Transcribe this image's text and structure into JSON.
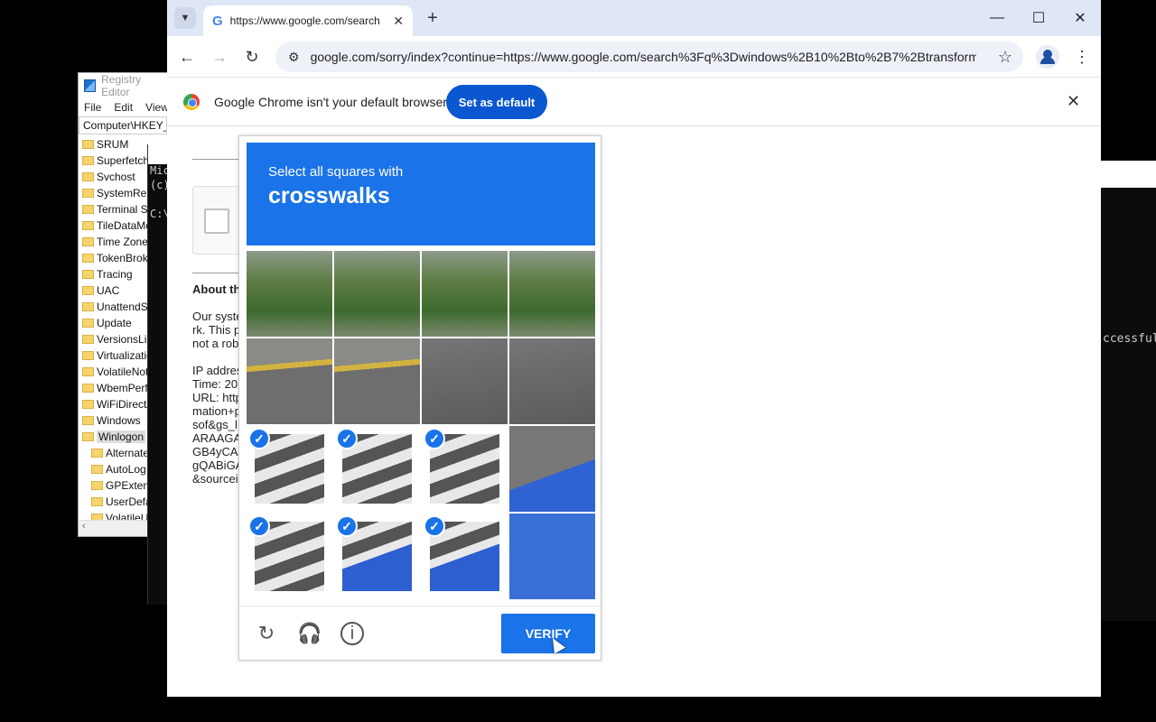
{
  "regedit": {
    "title": "Registry Editor",
    "menu": [
      "File",
      "Edit",
      "View"
    ],
    "address": "Computer\\HKEY_",
    "items": [
      "SRUM",
      "Superfetch",
      "Svchost",
      "SystemRest",
      "Terminal Se",
      "TileDataMo",
      "Time Zones",
      "TokenBroke",
      "Tracing",
      "UAC",
      "UnattendSe",
      "Update",
      "VersionsList",
      "Virtualizatio",
      "VolatileNoti",
      "WbemPerf",
      "WiFiDirectA",
      "Windows",
      "Winlogon"
    ],
    "subitems": [
      "Alternate",
      "AutoLog",
      "GPExtens",
      "UserDefa",
      "VolatileU"
    ]
  },
  "console": {
    "lines": [
      "Mic",
      "(c)",
      "",
      "C:\\"
    ]
  },
  "rconsole": {
    "message": "ccessful"
  },
  "chrome": {
    "tab_title": "https://www.google.com/search",
    "tab_favicon": "G",
    "url": "google.com/sorry/index?continue=https://www.google.com/search%3Fq%3Dwindows%2B10%2Bto%2B7%2Btransform...",
    "infobar_text": "Google Chrome isn't your default browser",
    "set_default_label": "Set as default"
  },
  "page": {
    "about_heading": "About th",
    "para_lines": [
      "Our syste",
      "rk. This p",
      "not a rob"
    ],
    "info_lines": [
      "IP addres",
      "Time: 20",
      "URL: http",
      "mation+p",
      "sof&gs_l",
      "ARAAGA",
      "GB4yCA",
      "gQABiGA",
      "&sourcei"
    ]
  },
  "captcha": {
    "instruction": "Select all squares with",
    "object": "crosswalks",
    "verify_label": "VERIFY",
    "tiles": [
      {
        "kind": "veg",
        "selected": false
      },
      {
        "kind": "veg",
        "selected": false
      },
      {
        "kind": "veg",
        "selected": false
      },
      {
        "kind": "veg",
        "selected": false
      },
      {
        "kind": "road-line",
        "selected": false
      },
      {
        "kind": "road-line",
        "selected": false
      },
      {
        "kind": "road",
        "selected": false
      },
      {
        "kind": "road",
        "selected": false
      },
      {
        "kind": "zebra",
        "selected": true
      },
      {
        "kind": "zebra",
        "selected": true
      },
      {
        "kind": "zebra",
        "selected": true
      },
      {
        "kind": "blue-road",
        "selected": false
      },
      {
        "kind": "zebra",
        "selected": true
      },
      {
        "kind": "zebra-blue",
        "selected": true
      },
      {
        "kind": "zebra-blue",
        "selected": true
      },
      {
        "kind": "blue",
        "selected": false
      }
    ],
    "accent": "#1a73e8"
  }
}
